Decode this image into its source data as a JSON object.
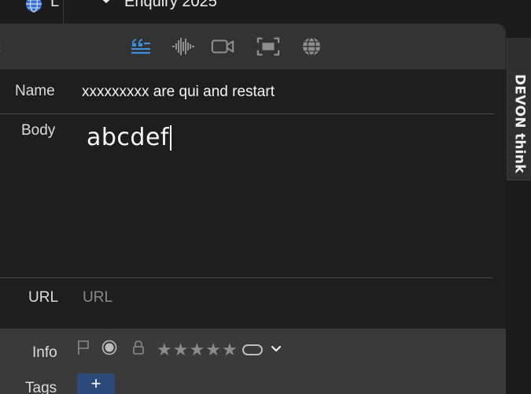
{
  "background_window": {
    "partial_text": "L",
    "document_title": "Enquiry 2025"
  },
  "side_tab": {
    "label": "DEVON think"
  },
  "toolbar": {
    "icons": [
      "quote-format-icon",
      "audio-waveform-icon",
      "video-camera-icon",
      "screenshot-icon",
      "web-globe-icon"
    ],
    "active_color": "#3d8fe0",
    "inactive_color": "#8f8f8f"
  },
  "fields": {
    "name_label": "Name",
    "name_value": "xxxxxxxxx are qui and restart",
    "body_label": "Body",
    "body_value": "abcdef",
    "url_label": "URL",
    "url_placeholder": "URL"
  },
  "bottom": {
    "info_label": "Info",
    "tags_label": "Tags",
    "rating": 0,
    "rating_max": 5,
    "add_tag_label": "+"
  }
}
